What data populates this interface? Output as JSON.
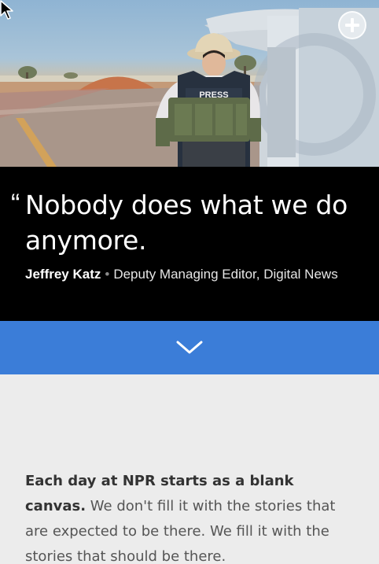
{
  "hero": {
    "vest_label": "PRESS",
    "plus_icon": "plus-icon",
    "cursor_icon": "mouse-pointer-icon"
  },
  "quote": {
    "open_mark": "“",
    "text": "Nobody does what we do anymore.",
    "author": "Jeffrey Katz",
    "separator": "•",
    "role": "Deputy Managing Editor, Digital News"
  },
  "expand": {
    "icon": "chevron-down-icon",
    "color": "#3b7dd8"
  },
  "intro": {
    "lead": "Each day at NPR starts as a blank canvas.",
    "rest": " We don't fill it with the stories that are expected to be there. We fill it with the stories that should be there."
  }
}
